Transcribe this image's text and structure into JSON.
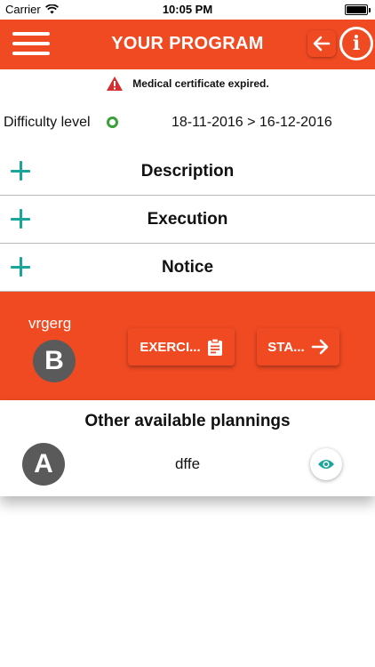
{
  "status_bar": {
    "carrier": "Carrier",
    "time": "10:05 PM",
    "icons": [
      "wifi-icon",
      "battery-icon"
    ]
  },
  "nav": {
    "title": "YOUR PROGRAM",
    "icons": [
      "menu-icon",
      "back-arrow-icon",
      "info-icon"
    ],
    "accent_color": "#f04a23"
  },
  "alert": {
    "message": "Medical certificate expired.",
    "icon": "warning-icon",
    "icon_color": "#d32f2f"
  },
  "difficulty": {
    "label": "Difficulty level",
    "level_color": "#3aa03a",
    "dates": "18-11-2016 > 16-12-2016"
  },
  "sections": [
    {
      "label": "Description"
    },
    {
      "label": "Execution"
    },
    {
      "label": "Notice"
    }
  ],
  "section_icon": "plus-icon",
  "section_icon_color": "#1aa59a",
  "program": {
    "name": "vrgerg",
    "avatar_letter": "B",
    "exercises_label": "EXERCI...",
    "exercises_icon": "clipboard-icon",
    "start_label": "STA...",
    "start_icon": "arrow-right-icon"
  },
  "plannings": {
    "heading": "Other available plannings",
    "items": [
      {
        "avatar_letter": "A",
        "name": "dffe",
        "action_icon": "eye-icon"
      }
    ]
  }
}
